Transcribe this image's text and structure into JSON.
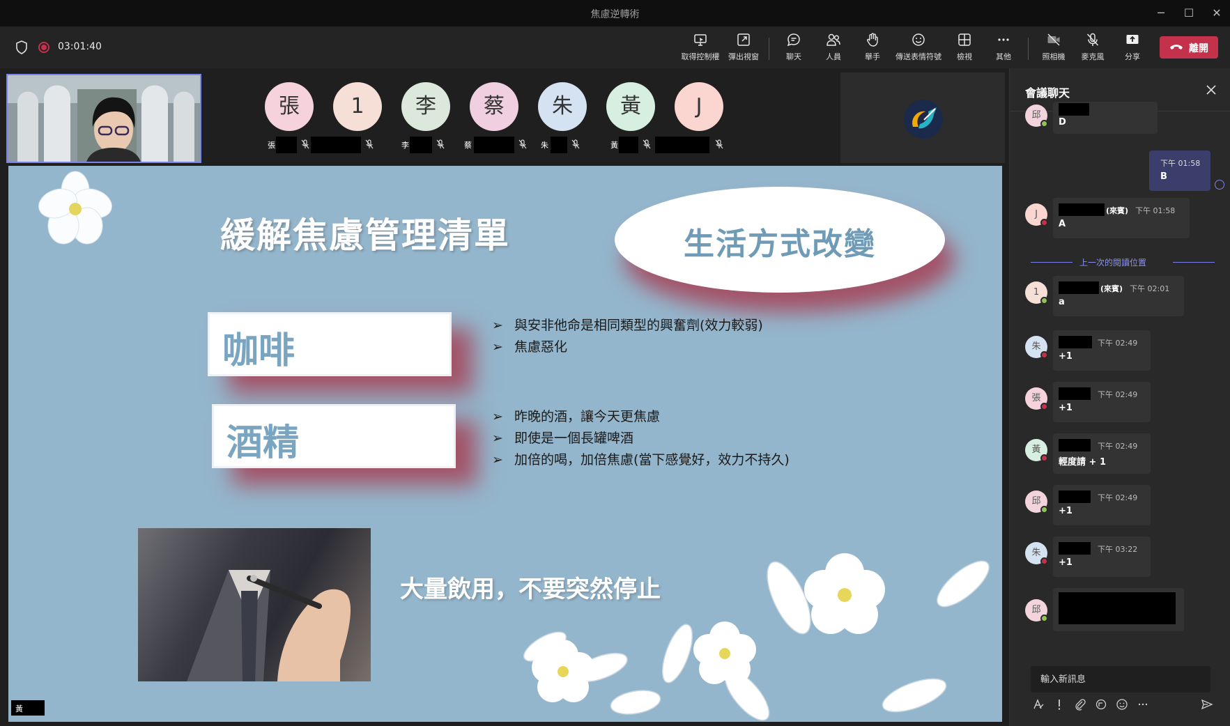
{
  "window": {
    "title": "焦慮逆轉術",
    "minimize_icon": "─",
    "maximize_icon": "☐",
    "close_icon": "✕"
  },
  "toolbar": {
    "timer": "03:01:40",
    "buttons": [
      {
        "label": "取得控制權",
        "icon": "control-icon"
      },
      {
        "label": "彈出視窗",
        "icon": "popout-icon"
      },
      {
        "label": "聊天",
        "icon": "chat-icon"
      },
      {
        "label": "人員",
        "icon": "people-icon"
      },
      {
        "label": "舉手",
        "icon": "raise-hand-icon"
      },
      {
        "label": "傳送表情符號",
        "icon": "emoji-icon"
      },
      {
        "label": "檢視",
        "icon": "view-icon"
      },
      {
        "label": "其他",
        "icon": "more-icon"
      },
      {
        "label": "照相機",
        "icon": "camera-off-icon"
      },
      {
        "label": "麥克風",
        "icon": "mic-off-icon"
      },
      {
        "label": "分享",
        "icon": "share-icon"
      }
    ],
    "leave_label": "離開",
    "leave_color": "#c4314b"
  },
  "participants": [
    {
      "initial": "張",
      "tag": "張",
      "color": "#f6d3dc"
    },
    {
      "initial": "1",
      "tag": "",
      "color": "#f5dfd6"
    },
    {
      "initial": "李",
      "tag": "李",
      "color": "#dde8dc"
    },
    {
      "initial": "蔡",
      "tag": "蔡",
      "color": "#f0cfe0"
    },
    {
      "initial": "朱",
      "tag": "朱",
      "color": "#d5e2f2"
    },
    {
      "initial": "黃",
      "tag": "黃",
      "color": "#d7efe0"
    },
    {
      "initial": "J",
      "tag": "",
      "color": "#fbd5cf"
    }
  ],
  "slide": {
    "title": "緩解焦慮管理清單",
    "badge": "生活方式改變",
    "card1": "咖啡",
    "card1_bullets": [
      "與安非他命是相同類型的興奮劑(效力較弱)",
      "焦慮惡化"
    ],
    "card2": "酒精",
    "card2_bullets": [
      "昨晚的酒，讓今天更焦慮",
      "即使是一個長罐啤酒",
      "加倍的喝，加倍焦慮(當下感覺好，效力不持久)"
    ],
    "bottom_text": "大量飲用，不要突然停止",
    "background": "#94b6cc"
  },
  "presenter_tag": "黃",
  "chat": {
    "title": "會議聊天",
    "my_message": {
      "time": "下午 01:58",
      "text": "B"
    },
    "last_read_label": "上一次的閱讀位置",
    "messages": [
      {
        "avatar": "邱",
        "role": "",
        "time": "下午 01:58",
        "text": "D",
        "avatar_color": "#f3d3dc",
        "status_color": "#92c353"
      },
      {
        "avatar": "J",
        "role": "(來賓)",
        "time": "下午 01:58",
        "text": "A",
        "avatar_color": "#fbd5cf",
        "status_color": "#c4314b"
      },
      {
        "avatar": "1",
        "role": "(來賓)",
        "time": "下午 02:01",
        "text": "a",
        "avatar_color": "#f5dfd6",
        "status_color": "#92c353"
      },
      {
        "avatar": "朱",
        "role": "",
        "time": "下午 02:49",
        "text": "+1",
        "avatar_color": "#d5e2f2",
        "status_color": "#c4314b"
      },
      {
        "avatar": "張",
        "role": "",
        "time": "下午 02:49",
        "text": "+1",
        "avatar_color": "#f6d3dc",
        "status_color": "#c4314b"
      },
      {
        "avatar": "黃",
        "role": "",
        "time": "下午 02:49",
        "text": "輕度請 + 1",
        "avatar_color": "#d7efe0",
        "status_color": "#c4314b"
      },
      {
        "avatar": "邱",
        "role": "",
        "time": "下午 02:49",
        "text": "+1",
        "avatar_color": "#f3d3dc",
        "status_color": "#92c353"
      },
      {
        "avatar": "朱",
        "role": "",
        "time": "下午 03:22",
        "text": "+1",
        "avatar_color": "#d5e2f2",
        "status_color": "#c4314b"
      },
      {
        "avatar": "邱",
        "role": "",
        "time": "",
        "text": "",
        "avatar_color": "#f3d3dc",
        "status_color": "#92c353"
      }
    ],
    "compose_placeholder": "輸入新訊息"
  }
}
